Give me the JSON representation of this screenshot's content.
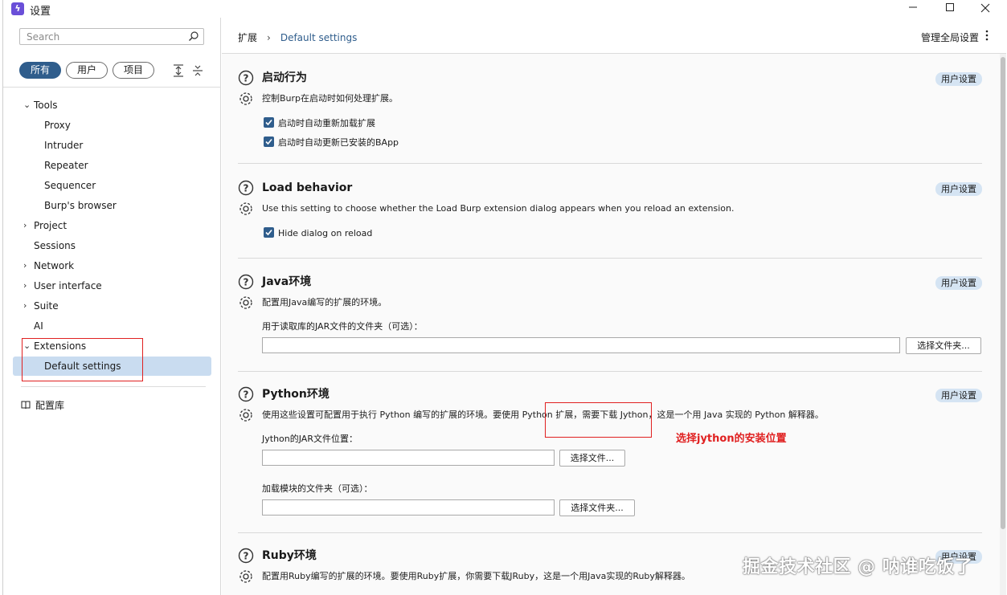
{
  "window": {
    "title": "设置",
    "app_icon": "burp-lightning-icon"
  },
  "sidebar": {
    "search_placeholder": "Search",
    "filters": [
      "所有",
      "用户",
      "项目"
    ],
    "tree": [
      {
        "label": "Tools",
        "expanded": true
      },
      {
        "label": "Proxy"
      },
      {
        "label": "Intruder"
      },
      {
        "label": "Repeater"
      },
      {
        "label": "Sequencer"
      },
      {
        "label": "Burp's browser"
      },
      {
        "label": "Project",
        "expanded": false
      },
      {
        "label": "Sessions"
      },
      {
        "label": "Network",
        "expanded": false
      },
      {
        "label": "User interface",
        "expanded": false
      },
      {
        "label": "Suite",
        "expanded": false
      },
      {
        "label": "AI"
      },
      {
        "label": "Extensions",
        "expanded": true
      },
      {
        "label": "Default settings",
        "selected": true
      }
    ],
    "library_label": "配置库"
  },
  "header": {
    "breadcrumb": [
      "扩展",
      "Default settings"
    ],
    "global_settings_label": "管理全局设置"
  },
  "sections": {
    "startup": {
      "title": "启动行为",
      "badge": "用户设置",
      "description": "控制Burp在启动时如何处理扩展。",
      "checkbox1": "启动时自动重新加载扩展",
      "checkbox2": "启动时自动更新已安装的BApp"
    },
    "load": {
      "title": "Load behavior",
      "badge": "用户设置",
      "description": "Use this setting to choose whether the Load Burp extension dialog appears when you reload an extension.",
      "checkbox1": "Hide dialog on reload"
    },
    "java": {
      "title": "Java环境",
      "badge": "用户设置",
      "description": "配置用Java编写的扩展的环境。",
      "field_label": "用于读取库的JAR文件的文件夹（可选）：",
      "button": "选择文件夹..."
    },
    "python": {
      "title": "Python环境",
      "badge": "用户设置",
      "description": "使用这些设置可配置用于执行 Python 编写的扩展的环境。要使用 Python 扩展，需要下载 Jython，这是一个用 Java 实现的 Python 解释器。",
      "jar_label": "Jython的JAR文件位置：",
      "jar_button": "选择文件...",
      "modules_label": "加载模块的文件夹（可选）：",
      "modules_button": "选择文件夹..."
    },
    "ruby": {
      "title": "Ruby环境",
      "badge": "用户设置",
      "description": "配置用Ruby编写的扩展的环境。要使用Ruby扩展，你需要下载JRuby，这是一个用Java实现的Ruby解释器。"
    }
  },
  "annotation": "选择jython的安装位置",
  "watermark": "掘金技术社区 @ 呐谁吃饭了",
  "colors": {
    "accent": "#2f5d8c",
    "selected_row": "#c9dcf0",
    "badge_bg": "#d5e4f3",
    "annotation_red": "#e02020"
  }
}
